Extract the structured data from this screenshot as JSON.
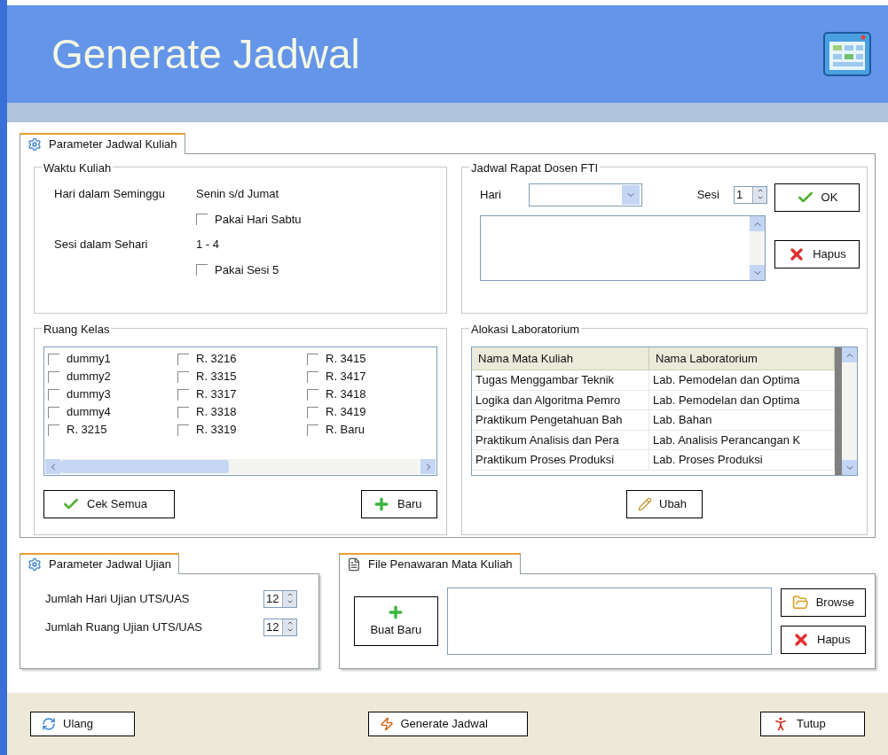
{
  "header": {
    "title": "Generate Jadwal"
  },
  "kuliah_tab": {
    "label": "Parameter Jadwal Kuliah",
    "selected": true
  },
  "waktu_kuliah": {
    "legend": "Waktu Kuliah",
    "items": [
      {
        "kind": "info",
        "label": "Hari dalam Seminggu",
        "value": "Senin s/d Jumat"
      },
      {
        "kind": "checkbox",
        "label": "Pakai Hari Sabtu",
        "checked": false
      },
      {
        "kind": "info",
        "label": "Sesi dalam Sehari",
        "value": "1 - 4"
      },
      {
        "kind": "checkbox",
        "label": "Pakai Sesi 5",
        "checked": false
      }
    ]
  },
  "jadwal_rapat": {
    "legend": "Jadwal Rapat Dosen FTI",
    "hari_label": "Hari",
    "sesi_label": "Sesi",
    "sesi_value": "1",
    "buttons": [
      {
        "label": "OK",
        "kind": "check"
      },
      {
        "label": "Hapus",
        "kind": "delete"
      }
    ]
  },
  "ruang_kelas": {
    "legend": "Ruang Kelas",
    "rooms": [
      {
        "label": "dummy1",
        "checked": false
      },
      {
        "label": "dummy2",
        "checked": false
      },
      {
        "label": "dummy3",
        "checked": false
      },
      {
        "label": "dummy4",
        "checked": false
      },
      {
        "label": "R. 3215",
        "checked": false
      },
      {
        "label": "R. 3216",
        "checked": false
      },
      {
        "label": "R. 3315",
        "checked": false
      },
      {
        "label": "R. 3317",
        "checked": false
      },
      {
        "label": "R. 3318",
        "checked": false
      },
      {
        "label": "R. 3319",
        "checked": false
      },
      {
        "label": "R. 3415",
        "checked": false
      },
      {
        "label": "R. 3417",
        "checked": false
      },
      {
        "label": "R. 3418",
        "checked": false
      },
      {
        "label": "R. 3419",
        "checked": false
      },
      {
        "label": "R. Baru",
        "checked": false
      }
    ],
    "buttons": [
      {
        "label": "Cek Semua",
        "kind": "check"
      },
      {
        "label": "Baru",
        "kind": "add"
      }
    ]
  },
  "alokasi": {
    "legend": "Alokasi Laboratorium",
    "columns": [
      "Nama Mata Kuliah",
      "Nama Laboratorium"
    ],
    "rows": [
      [
        "Tugas Menggambar Teknik",
        "Lab. Pemodelan dan Optima"
      ],
      [
        "Logika dan Algoritma Pemro",
        "Lab. Pemodelan dan Optima"
      ],
      [
        "Praktikum Pengetahuan Bah",
        "Lab. Bahan"
      ],
      [
        "Praktikum Analisis dan Pera",
        "Lab. Analisis Perancangan K"
      ],
      [
        "Praktikum Proses Produksi",
        "Lab. Proses Produksi"
      ]
    ],
    "button": {
      "label": "Ubah",
      "kind": "edit"
    }
  },
  "ujian_tab": {
    "label": "Parameter Jadwal Ujian",
    "selected": true,
    "fields": [
      {
        "label": "Jumlah Hari Ujian UTS/UAS",
        "value": "12"
      },
      {
        "label": "Jumlah Ruang Ujian UTS/UAS",
        "value": "12"
      }
    ]
  },
  "file_tab": {
    "label": "File Penawaran Mata Kuliah",
    "selected": true,
    "new_button": {
      "label": "Buat Baru",
      "kind": "add"
    },
    "buttons": [
      {
        "label": "Browse",
        "kind": "folder"
      },
      {
        "label": "Hapus",
        "kind": "delete"
      }
    ]
  },
  "footer": {
    "buttons": [
      {
        "label": "Ulang",
        "kind": "reset"
      },
      {
        "label": "Generate Jadwal",
        "kind": "generate"
      },
      {
        "label": "Tutup",
        "kind": "exit"
      }
    ]
  }
}
